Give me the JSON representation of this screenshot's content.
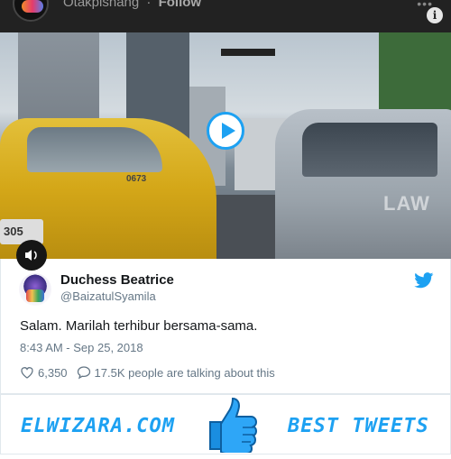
{
  "video": {
    "owner_name": "Otakpishang",
    "follow_label": "Follow",
    "info_label": "i",
    "watermark": "LAW",
    "plate_text": "305",
    "taxi_number": "0673"
  },
  "tweet": {
    "display_name": "Duchess Beatrice",
    "handle": "@BaizatulSyamila",
    "text": "Salam. Marilah terhibur bersama-sama.",
    "timestamp": "8:43 AM - Sep 25, 2018",
    "like_count": "6,350",
    "talking_text": "17.5K people are talking about this"
  },
  "banner": {
    "left_text": "ELWIZARA.COM",
    "right_text": "BEST TWEETS"
  },
  "icons": {
    "brand": "twitter-bird-icon",
    "like": "heart-icon",
    "reply": "speech-bubble-icon",
    "play": "play-icon",
    "mute": "speaker-icon",
    "thumb": "thumbs-up-icon"
  },
  "colors": {
    "accent": "#1da1f2",
    "text": "#14171a",
    "muted": "#657786"
  }
}
